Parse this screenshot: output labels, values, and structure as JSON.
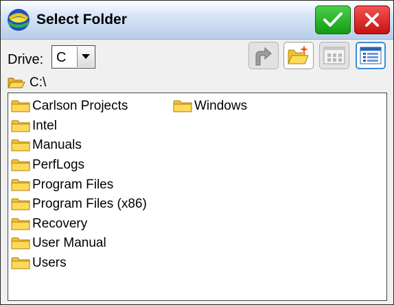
{
  "window": {
    "title": "Select Folder",
    "ok_icon": "checkmark-icon",
    "cancel_icon": "close-icon"
  },
  "toolbar": {
    "drive_label": "Drive:",
    "drive_value": "C",
    "buttons": [
      {
        "name": "up-folder-button",
        "icon": "folder-up-icon",
        "enabled": false
      },
      {
        "name": "new-folder-button",
        "icon": "new-folder-icon",
        "enabled": true
      },
      {
        "name": "icon-view-button",
        "icon": "large-icons-view-icon",
        "enabled": false
      },
      {
        "name": "list-view-button",
        "icon": "list-view-icon",
        "enabled": true,
        "selected": true
      }
    ]
  },
  "current_path": "C:\\",
  "folders": {
    "column1": [
      "Carlson Projects",
      "Intel",
      "Manuals",
      "PerfLogs",
      "Program Files",
      "Program Files (x86)",
      "Recovery",
      "User Manual",
      "Users"
    ],
    "column2": [
      "Windows"
    ]
  },
  "colors": {
    "ok_green": "#1fb01f",
    "cancel_red": "#d91a1a",
    "folder_yellow": "#f2c230",
    "selected_border": "#3a8ad6"
  }
}
